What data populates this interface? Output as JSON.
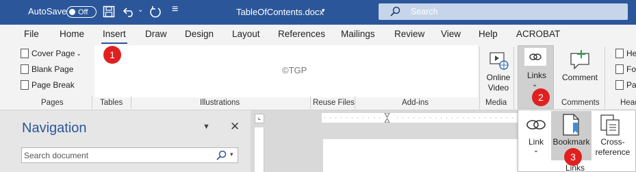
{
  "titlebar": {
    "autosave_label": "AutoSave",
    "autosave_state": "Off",
    "doc_title": "TableOfContents.docx",
    "search_label": "Search"
  },
  "menu": {
    "tabs": [
      "File",
      "Home",
      "Insert",
      "Draw",
      "Design",
      "Layout",
      "References",
      "Mailings",
      "Review",
      "View",
      "Help",
      "ACROBAT"
    ],
    "active": "Insert"
  },
  "ribbon": {
    "pages": [
      "Cover Page",
      "Blank Page",
      "Page Break"
    ],
    "groups": [
      "Pages",
      "Tables",
      "Illustrations",
      "Reuse Files",
      "Add-ins",
      "Media",
      "Comments",
      "Head"
    ],
    "watermark": "©TGP",
    "online_video_1": "Online",
    "online_video_2": "Video",
    "links_label": "Links",
    "comment_label": "Comment",
    "right_cut": [
      "He",
      "Fo",
      "Pa"
    ]
  },
  "navigation": {
    "title": "Navigation",
    "search_placeholder": "Search document"
  },
  "dropdown": {
    "link": "Link",
    "bookmark": "Bookmark",
    "cross1": "Cross-",
    "cross2": "reference",
    "group_label": "Links"
  },
  "badges": [
    "1",
    "2",
    "3"
  ],
  "colors": {
    "titlebar": "#2b579a",
    "badge": "#e02020"
  }
}
